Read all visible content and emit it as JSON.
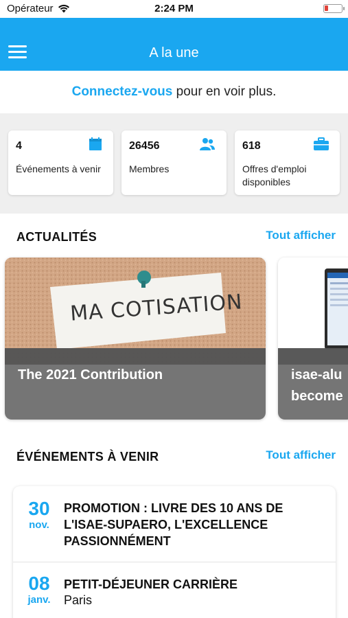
{
  "status_bar": {
    "carrier": "Opérateur",
    "time": "2:24 PM"
  },
  "header": {
    "title": "A la une",
    "menu_icon": "hamburger-menu-icon"
  },
  "banner": {
    "link_text": "Connectez-vous",
    "rest_text": " pour en voir plus."
  },
  "stats": [
    {
      "value": "4",
      "label": "Événements à venir",
      "icon": "calendar-icon"
    },
    {
      "value": "26456",
      "label": "Membres",
      "icon": "users-icon"
    },
    {
      "value": "618",
      "label": "Offres d'emploi disponibles",
      "icon": "briefcase-icon"
    }
  ],
  "news_section": {
    "title": "ACTUALITÉS",
    "see_all": "Tout afficher",
    "items": [
      {
        "title": "The 2021 Contribution",
        "image_text": "MA COTISATION"
      },
      {
        "title": "isae-alu become"
      }
    ]
  },
  "events_section": {
    "title": "ÉVÉNEMENTS À VENIR",
    "see_all": "Tout afficher",
    "items": [
      {
        "day": "30",
        "month": "nov.",
        "title": "PROMOTION : LIVRE DES 10 ANS DE L'ISAE-SUPAERO, L'EXCELLENCE PASSIONNÉMENT",
        "location": ""
      },
      {
        "day": "08",
        "month": "janv.",
        "title": "PETIT-DÉJEUNER CARRIÈRE",
        "location": "Paris"
      }
    ]
  },
  "colors": {
    "accent": "#1aa7f0",
    "background_gray": "#efefef"
  }
}
